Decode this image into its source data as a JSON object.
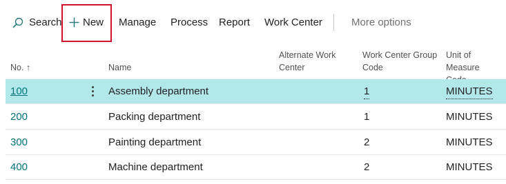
{
  "toolbar": {
    "search_label": "Search",
    "new_label": "New",
    "items": [
      "Manage",
      "Process",
      "Report",
      "Work Center"
    ],
    "more_label": "More options"
  },
  "columns": {
    "no": "No. ↑",
    "name": "Name",
    "alternate_work_center": [
      "Alternate Work",
      "Center"
    ],
    "work_center_group_code": [
      "Work Center Group",
      "Code"
    ],
    "unit_of_measure_code": [
      "Unit of Measure",
      "Code"
    ]
  },
  "rows": [
    {
      "no": "100",
      "name": "Assembly department",
      "group_code": "1",
      "uom": "MINUTES"
    },
    {
      "no": "200",
      "name": "Packing department",
      "group_code": "1",
      "uom": "MINUTES"
    },
    {
      "no": "300",
      "name": "Painting department",
      "group_code": "2",
      "uom": "MINUTES"
    },
    {
      "no": "400",
      "name": "Machine department",
      "group_code": "2",
      "uom": "MINUTES"
    }
  ],
  "colors": {
    "accent_link": "#00737a",
    "selected_row": "#b3e8ea",
    "highlight_box": "#d0112b"
  }
}
